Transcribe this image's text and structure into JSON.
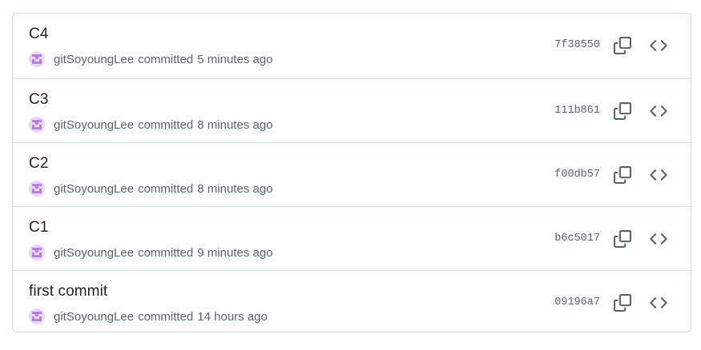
{
  "commits": [
    {
      "title": "C4",
      "author": "gitSoyoungLee",
      "action": "committed",
      "time": "5 minutes ago",
      "sha": "7f38550"
    },
    {
      "title": "C3",
      "author": "gitSoyoungLee",
      "action": "committed",
      "time": "8 minutes ago",
      "sha": "111b861"
    },
    {
      "title": "C2",
      "author": "gitSoyoungLee",
      "action": "committed",
      "time": "8 minutes ago",
      "sha": "f00db57"
    },
    {
      "title": "C1",
      "author": "gitSoyoungLee",
      "action": "committed",
      "time": "9 minutes ago",
      "sha": "b6c5017"
    },
    {
      "title": "first commit",
      "author": "gitSoyoungLee",
      "action": "committed",
      "time": "14 hours ago",
      "sha": "09196a7"
    }
  ],
  "icons": {
    "copy": "copy-icon",
    "browse": "code-icon",
    "avatar": "identicon-avatar"
  },
  "colors": {
    "text_primary": "#1f2328",
    "text_muted": "#59636e",
    "border": "#d0d7de",
    "avatar_bg": "#e7d8f6",
    "avatar_fg": "#b57ee5"
  }
}
